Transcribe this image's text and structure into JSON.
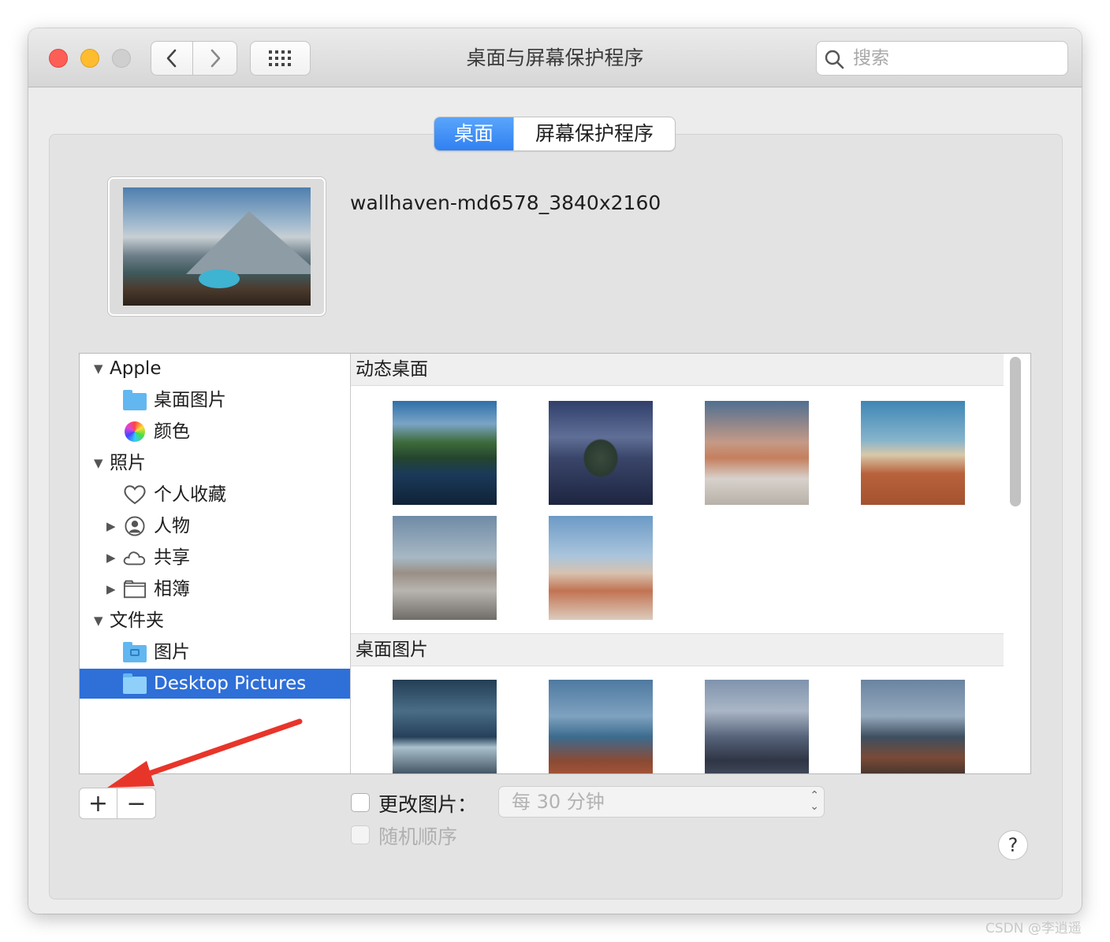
{
  "window": {
    "title": "桌面与屏幕保护程序",
    "search_placeholder": "搜索"
  },
  "tabs": [
    {
      "label": "桌面",
      "selected": true
    },
    {
      "label": "屏幕保护程序",
      "selected": false
    }
  ],
  "current_wallpaper": {
    "name": "wallhaven-md6578_3840x2160"
  },
  "sidebar": {
    "groups": [
      {
        "label": "Apple",
        "expanded": true,
        "items": [
          {
            "label": "桌面图片",
            "icon": "folder-icon"
          },
          {
            "label": "颜色",
            "icon": "color-wheel-icon"
          }
        ]
      },
      {
        "label": "照片",
        "expanded": true,
        "items": [
          {
            "label": "个人收藏",
            "icon": "heart-icon"
          },
          {
            "label": "人物",
            "icon": "person-icon",
            "collapsed": true
          },
          {
            "label": "共享",
            "icon": "cloud-icon",
            "collapsed": true
          },
          {
            "label": "相簿",
            "icon": "album-icon",
            "collapsed": true
          }
        ]
      },
      {
        "label": "文件夹",
        "expanded": true,
        "items": [
          {
            "label": "图片",
            "icon": "pictures-folder-icon"
          },
          {
            "label": "Desktop Pictures",
            "icon": "folder-icon",
            "selected": true
          }
        ]
      }
    ]
  },
  "sections": [
    {
      "title": "动态桌面",
      "thumbnail_count": 6
    },
    {
      "title": "桌面图片",
      "thumbnail_count": 4
    }
  ],
  "controls": {
    "add_label": "+",
    "remove_label": "−",
    "change_picture_label": "更改图片：",
    "change_picture_checked": false,
    "interval_value": "每 30 分钟",
    "random_order_label": "随机顺序",
    "random_order_enabled": false,
    "help_label": "?"
  },
  "watermark": "CSDN @李逍遥",
  "colors": {
    "accent": "#2e6fd8",
    "tab_selected": "#3b8af5",
    "arrow": "#e8352a"
  }
}
